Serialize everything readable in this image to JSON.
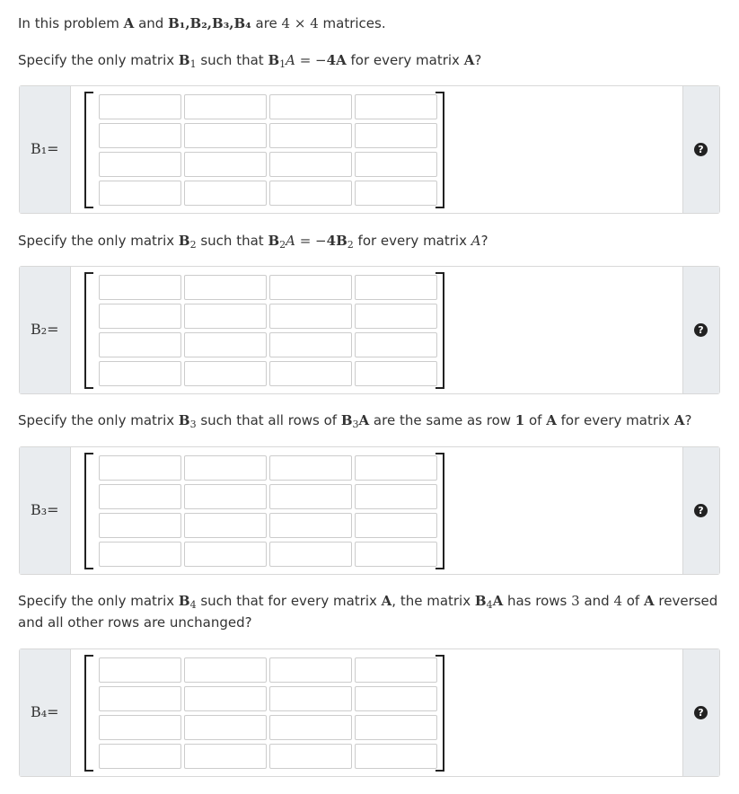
{
  "intro": {
    "t1": "In this problem ",
    "a": "A",
    "t2": " and ",
    "mats": "B₁,B₂,B₃,B₄",
    "t3": " are ",
    "dim": "4 × 4",
    "t4": " matrices."
  },
  "questions": [
    {
      "t1": "Specify the only matrix ",
      "b": "B",
      "sub": "1",
      "t2": " such that ",
      "expr_b": "B",
      "expr_sub": "1",
      "expr_rest": "A = −",
      "expr_bold": "4A",
      "t3": " for every matrix ",
      "t4": "A",
      "t5": "?",
      "label": "B₁="
    },
    {
      "t1": "Specify the only matrix ",
      "b": "B",
      "sub": "2",
      "t2": " such that ",
      "expr_b": "B",
      "expr_sub": "2",
      "expr_rest": "A = −",
      "expr_bold": "4B",
      "expr_bold_sub": "2",
      "t3": " for every matrix ",
      "t4": "A",
      "t5": "?",
      "label": "B₂="
    },
    {
      "t1": "Specify the only matrix ",
      "b": "B",
      "sub": "3",
      "t2": " such that all rows of ",
      "expr_b": "B",
      "expr_sub": "3",
      "expr_bold": "A",
      "t3": " are the same as row ",
      "row": "1",
      "t4": " of ",
      "a": "A",
      "t5": " for every matrix ",
      "a2": "A",
      "t6": "?",
      "label": "B₃="
    },
    {
      "t1": "Specify the only matrix ",
      "b": "B",
      "sub": "4",
      "t2": " such that for every matrix ",
      "a": "A",
      "t3": ", the matrix ",
      "expr_b": "B",
      "expr_sub": "4",
      "expr_bold": "A",
      "t4": " has rows ",
      "r1": "3",
      "t5": " and ",
      "r2": "4",
      "t6": " of ",
      "a2": "A",
      "t7": " reversed and all other rows are unchanged?",
      "label": "B₄="
    }
  ],
  "help_icon": "?",
  "matrix": {
    "rows": 4,
    "cols": 4
  }
}
